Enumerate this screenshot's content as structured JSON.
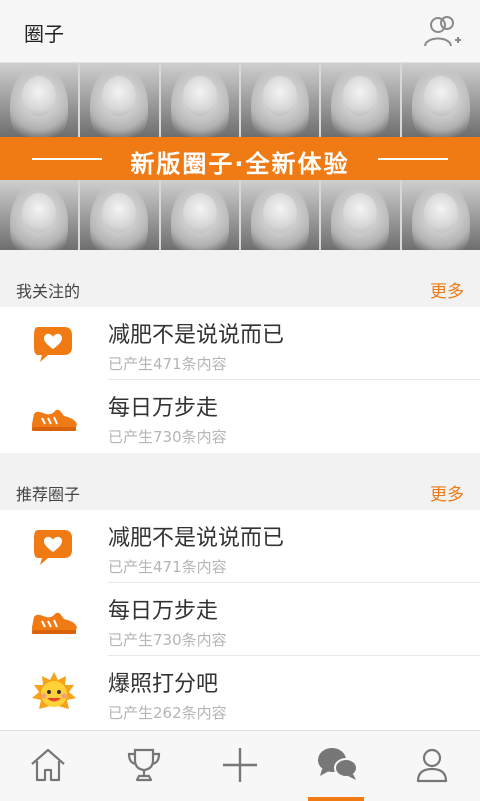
{
  "header": {
    "title": "圈子",
    "add_friend_icon": "add-friend-icon"
  },
  "banner": {
    "text": "新版圈子·全新体验",
    "accent_color": "#f07a14"
  },
  "followed": {
    "label": "我关注的",
    "more": "更多",
    "items": [
      {
        "name": "减肥不是说说而已",
        "count": "已产生471条内容",
        "icon": "heart-bubble-icon"
      },
      {
        "name": "每日万步走",
        "count": "已产生730条内容",
        "icon": "sneaker-icon"
      }
    ]
  },
  "recommended": {
    "label": "推荐圈子",
    "more": "更多",
    "items": [
      {
        "name": "减肥不是说说而已",
        "count": "已产生471条内容",
        "icon": "heart-bubble-icon"
      },
      {
        "name": "每日万步走",
        "count": "已产生730条内容",
        "icon": "sneaker-icon"
      },
      {
        "name": "爆照打分吧",
        "count": "已产生262条内容",
        "icon": "sun-face-icon"
      }
    ]
  },
  "tabbar": {
    "tabs": [
      {
        "icon": "home-icon",
        "active": false
      },
      {
        "icon": "trophy-icon",
        "active": false
      },
      {
        "icon": "plus-icon",
        "active": false
      },
      {
        "icon": "chat-bubbles-icon",
        "active": true
      },
      {
        "icon": "profile-icon",
        "active": false
      }
    ]
  }
}
